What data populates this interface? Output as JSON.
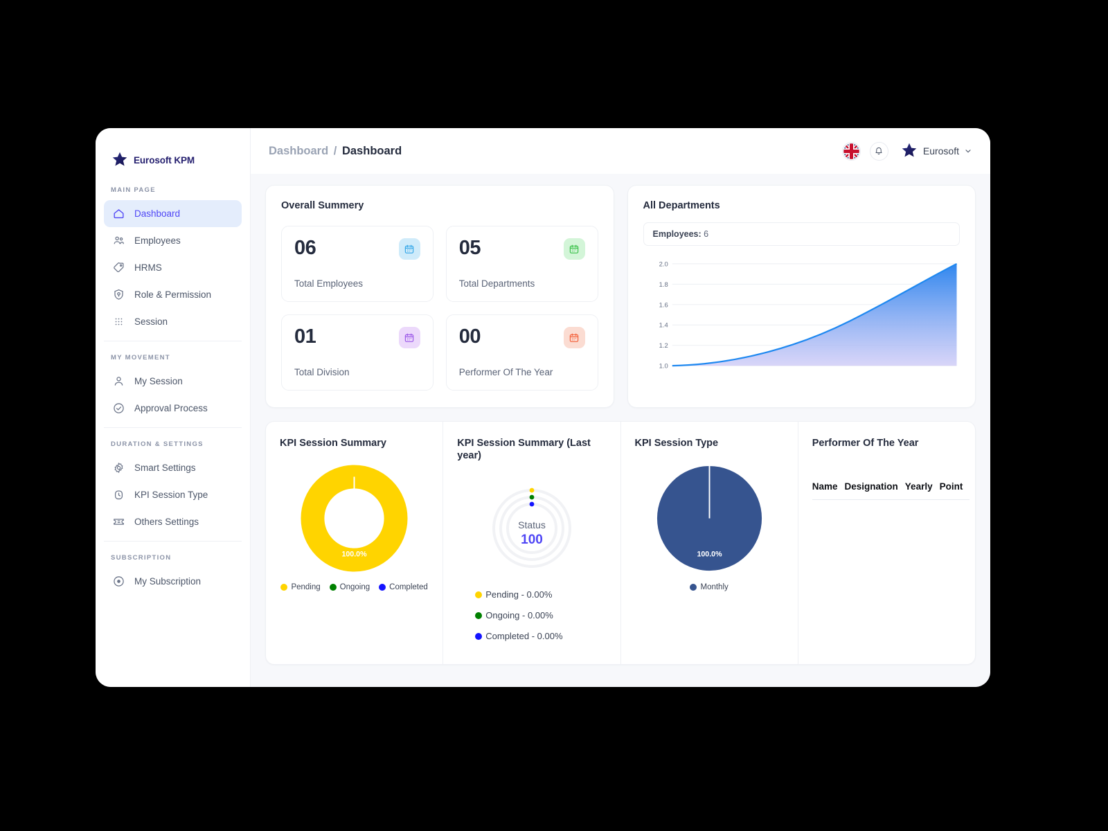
{
  "brand": {
    "name": "Eurosoft KPM",
    "logo_icon": "star-icon"
  },
  "sidebar": {
    "sections": [
      {
        "label": "MAIN PAGE",
        "items": [
          {
            "label": "Dashboard",
            "icon": "home-icon",
            "active": true
          },
          {
            "label": "Employees",
            "icon": "users-icon",
            "active": false
          },
          {
            "label": "HRMS",
            "icon": "tag-icon",
            "active": false
          },
          {
            "label": "Role & Permission",
            "icon": "shield-check-icon",
            "active": false
          },
          {
            "label": "Session",
            "icon": "grid-dots-icon",
            "active": false
          }
        ]
      },
      {
        "label": "MY MOVEMENT",
        "items": [
          {
            "label": "My Session",
            "icon": "user-icon",
            "active": false
          },
          {
            "label": "Approval Process",
            "icon": "check-circle-icon",
            "active": false
          }
        ]
      },
      {
        "label": "DURATION & SETTINGS",
        "items": [
          {
            "label": "Smart Settings",
            "icon": "gear-icon",
            "active": false
          },
          {
            "label": "KPI Session Type",
            "icon": "clock-icon",
            "active": false
          },
          {
            "label": "Others Settings",
            "icon": "ticket-icon",
            "active": false
          }
        ]
      },
      {
        "label": "SUBSCRIPTION",
        "items": [
          {
            "label": "My Subscription",
            "icon": "coin-icon",
            "active": false
          }
        ]
      }
    ]
  },
  "topbar": {
    "breadcrumb_parent": "Dashboard",
    "breadcrumb_separator": "/",
    "breadcrumb_current": "Dashboard",
    "language_icon": "uk-flag-icon",
    "notification_icon": "bell-icon",
    "user_avatar_icon": "star-icon",
    "user_name": "Eurosoft",
    "user_chevron_icon": "chevron-down-icon"
  },
  "summary": {
    "title": "Overall Summery",
    "stats": [
      {
        "value": "06",
        "label": "Total Employees",
        "icon": "calendar-icon",
        "accent": "#35A7E8",
        "bg": "#CFEBFA"
      },
      {
        "value": "05",
        "label": "Total Departments",
        "icon": "calendar-icon",
        "accent": "#3BC14A",
        "bg": "#D3F5D8"
      },
      {
        "value": "01",
        "label": "Total Division",
        "icon": "calendar-icon",
        "accent": "#9B59E8",
        "bg": "#ECD9FB"
      },
      {
        "value": "00",
        "label": "Performer Of The Year",
        "icon": "calendar-icon",
        "accent": "#F4613B",
        "bg": "#FBDCD2"
      }
    ]
  },
  "departments": {
    "title": "All Departments",
    "badge_label": "Employees:",
    "badge_value": "6"
  },
  "panels": {
    "kpi_summary_title": "KPI Session Summary",
    "kpi_summary_last_title": "KPI Session Summary (Last year)",
    "kpi_type_title": "KPI Session Type",
    "performer_title": "Performer Of The Year",
    "donut_label": "100.0%",
    "pie_label": "100.0%",
    "radial_status_label": "Status",
    "radial_status_value": "100",
    "kpi_legend": [
      {
        "label": "Pending",
        "color": "#FFD400"
      },
      {
        "label": "Ongoing",
        "color": "#008000"
      },
      {
        "label": "Completed",
        "color": "#1414FF"
      }
    ],
    "kpi_last_legend": [
      {
        "label": "Pending - 0.00%",
        "color": "#FFD400"
      },
      {
        "label": "Ongoing - 0.00%",
        "color": "#008000"
      },
      {
        "label": "Completed - 0.00%",
        "color": "#1414FF"
      }
    ],
    "kpi_type_legend": [
      {
        "label": "Monthly",
        "color": "#36548F"
      }
    ],
    "performer_columns": [
      "Name",
      "Designation",
      "Yearly",
      "Point"
    ],
    "performer_rows": []
  },
  "chart_data": [
    {
      "type": "area",
      "title": "All Departments",
      "xlabel": "",
      "ylabel": "",
      "ylim": [
        1.0,
        2.0
      ],
      "yticks": [
        1.0,
        1.2,
        1.4,
        1.6,
        1.8,
        2.0
      ],
      "ytick_labels": [
        "1.0",
        "1.2",
        "1.4",
        "1.6",
        "1.8",
        "2.0"
      ],
      "grid": true,
      "legend": "none",
      "series": [
        {
          "name": "Employees",
          "x": [
            0,
            1,
            2,
            3,
            4,
            5,
            6,
            7,
            8,
            9,
            10
          ],
          "values": [
            1.0,
            1.01,
            1.04,
            1.09,
            1.16,
            1.25,
            1.36,
            1.49,
            1.64,
            1.81,
            2.0
          ],
          "line_color": "#1E88F0",
          "fill_top": "#2F86EE",
          "fill_bottom": "#CBC7F6"
        }
      ],
      "annotation": "Employees: 6"
    },
    {
      "type": "pie",
      "title": "KPI Session Summary",
      "variant": "donut",
      "labels": [
        "Pending",
        "Ongoing",
        "Completed"
      ],
      "values": [
        100.0,
        0.0,
        0.0
      ],
      "colors": [
        "#FFD400",
        "#008000",
        "#1414FF"
      ],
      "data_labels": [
        "100.0%"
      ],
      "legend": "bottom"
    },
    {
      "type": "pie",
      "title": "KPI Session Summary (Last year)",
      "variant": "radial-empty",
      "labels": [
        "Pending",
        "Ongoing",
        "Completed"
      ],
      "values": [
        0.0,
        0.0,
        0.0
      ],
      "colors": [
        "#FFD400",
        "#008000",
        "#1414FF"
      ],
      "center_label": "Status",
      "center_value": "100",
      "legend": "right"
    },
    {
      "type": "pie",
      "title": "KPI Session Type",
      "variant": "pie",
      "labels": [
        "Monthly"
      ],
      "values": [
        100.0
      ],
      "colors": [
        "#36548F"
      ],
      "data_labels": [
        "100.0%"
      ],
      "legend": "bottom"
    }
  ]
}
